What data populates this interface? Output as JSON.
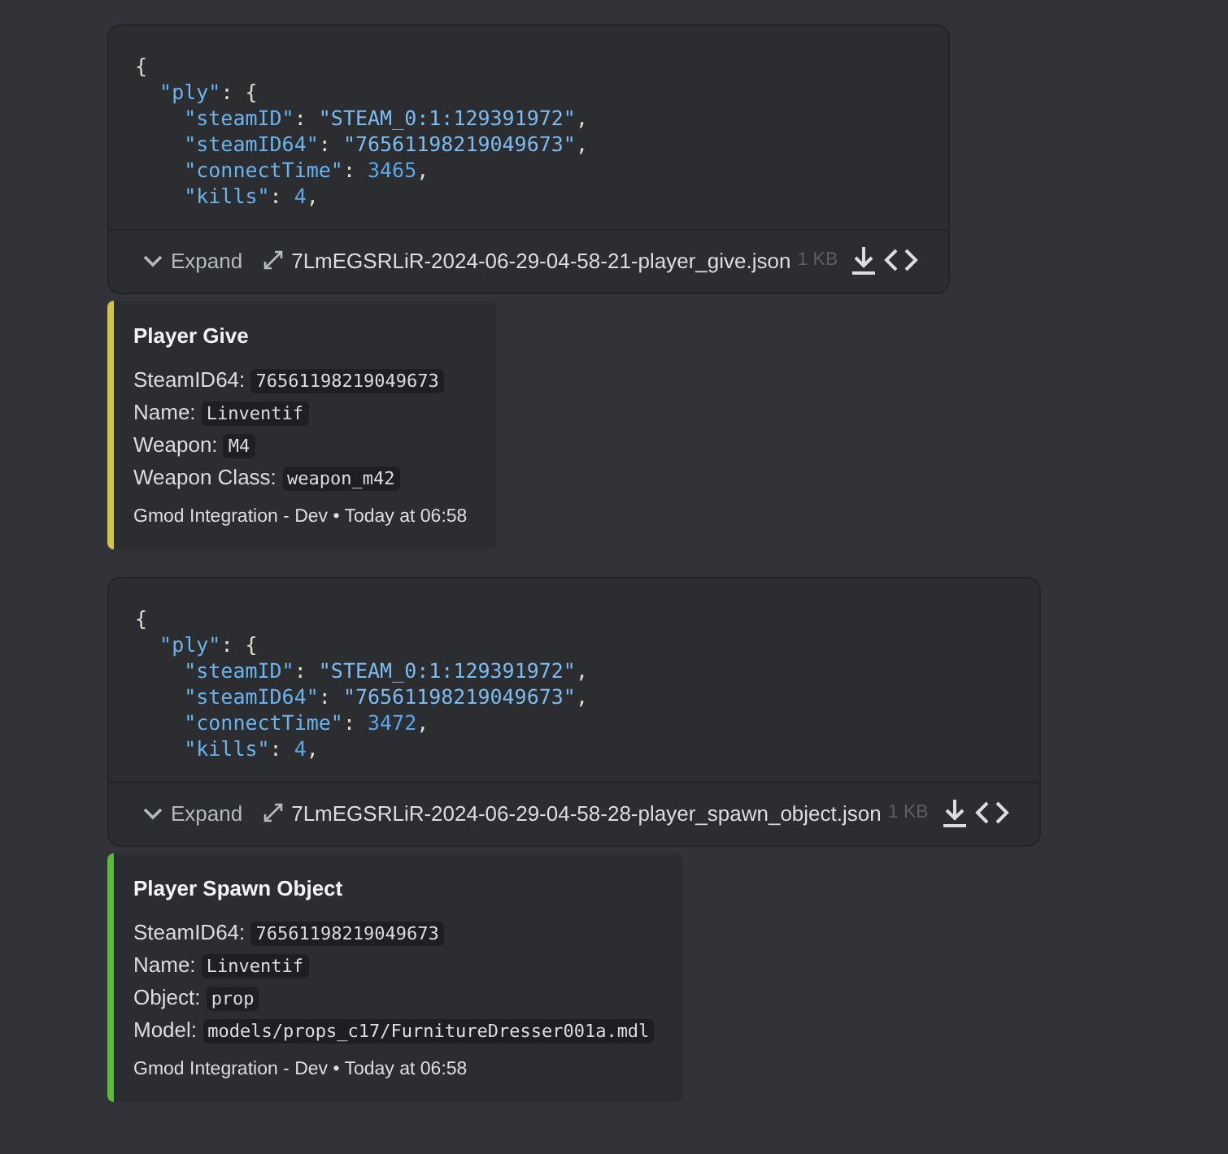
{
  "messages": [
    {
      "attachment": {
        "code_lines": [
          [
            {
              "kind": "punct",
              "text": "{"
            }
          ],
          [
            {
              "kind": "key",
              "text": "  \"ply\""
            },
            {
              "kind": "punct",
              "text": ": {"
            }
          ],
          [
            {
              "kind": "key",
              "text": "    \"steamID\""
            },
            {
              "kind": "punct",
              "text": ": "
            },
            {
              "kind": "string",
              "text": "\"STEAM_0:1:129391972\""
            },
            {
              "kind": "punct",
              "text": ","
            }
          ],
          [
            {
              "kind": "key",
              "text": "    \"steamID64\""
            },
            {
              "kind": "punct",
              "text": ": "
            },
            {
              "kind": "string",
              "text": "\"76561198219049673\""
            },
            {
              "kind": "punct",
              "text": ","
            }
          ],
          [
            {
              "kind": "key",
              "text": "    \"connectTime\""
            },
            {
              "kind": "punct",
              "text": ": "
            },
            {
              "kind": "number",
              "text": "3465"
            },
            {
              "kind": "punct",
              "text": ","
            }
          ],
          [
            {
              "kind": "key",
              "text": "    \"kills\""
            },
            {
              "kind": "punct",
              "text": ": "
            },
            {
              "kind": "number",
              "text": "4"
            },
            {
              "kind": "punct",
              "text": ","
            }
          ]
        ],
        "expand_label": "Expand",
        "filename": "7LmEGSRLiR-2024-06-29-04-58-21-player_give.json",
        "size": "1 KB"
      },
      "embed": {
        "color": "#d4c346",
        "title": "Player Give",
        "fields": [
          {
            "label": "SteamID64:",
            "value": "76561198219049673"
          },
          {
            "label": "Name:",
            "value": "Linventif"
          },
          {
            "label": "Weapon:",
            "value": "M4"
          },
          {
            "label": "Weapon Class:",
            "value": "weapon_m42"
          }
        ],
        "footer": "Gmod Integration - Dev • Today at 06:58"
      }
    },
    {
      "attachment": {
        "code_lines": [
          [
            {
              "kind": "punct",
              "text": "{"
            }
          ],
          [
            {
              "kind": "key",
              "text": "  \"ply\""
            },
            {
              "kind": "punct",
              "text": ": {"
            }
          ],
          [
            {
              "kind": "key",
              "text": "    \"steamID\""
            },
            {
              "kind": "punct",
              "text": ": "
            },
            {
              "kind": "string",
              "text": "\"STEAM_0:1:129391972\""
            },
            {
              "kind": "punct",
              "text": ","
            }
          ],
          [
            {
              "kind": "key",
              "text": "    \"steamID64\""
            },
            {
              "kind": "punct",
              "text": ": "
            },
            {
              "kind": "string",
              "text": "\"76561198219049673\""
            },
            {
              "kind": "punct",
              "text": ","
            }
          ],
          [
            {
              "kind": "key",
              "text": "    \"connectTime\""
            },
            {
              "kind": "punct",
              "text": ": "
            },
            {
              "kind": "number",
              "text": "3472"
            },
            {
              "kind": "punct",
              "text": ","
            }
          ],
          [
            {
              "kind": "key",
              "text": "    \"kills\""
            },
            {
              "kind": "punct",
              "text": ": "
            },
            {
              "kind": "number",
              "text": "4"
            },
            {
              "kind": "punct",
              "text": ","
            }
          ]
        ],
        "expand_label": "Expand",
        "filename": "7LmEGSRLiR-2024-06-29-04-58-28-player_spawn_object.json",
        "size": "1 KB"
      },
      "embed": {
        "color": "#5dbb3c",
        "title": "Player Spawn Object",
        "fields": [
          {
            "label": "SteamID64:",
            "value": "76561198219049673"
          },
          {
            "label": "Name:",
            "value": "Linventif"
          },
          {
            "label": "Object:",
            "value": "prop"
          },
          {
            "label": "Model:",
            "value": "models/props_c17/FurnitureDresser001a.mdl"
          }
        ],
        "footer": "Gmod Integration - Dev • Today at 06:58"
      }
    }
  ]
}
